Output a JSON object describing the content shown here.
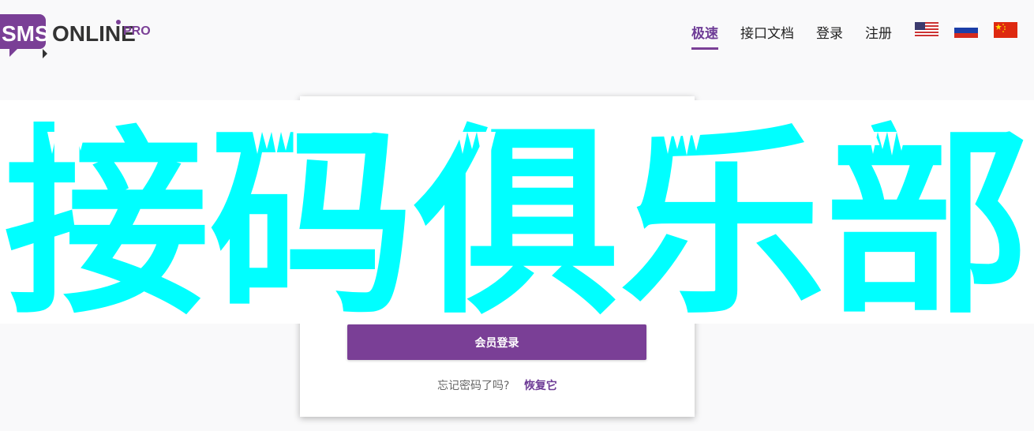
{
  "logo": {
    "sms": "SMS",
    "online": "ONLINE",
    "pro": "PRO"
  },
  "nav": {
    "items": [
      {
        "label": "极速",
        "active": true
      },
      {
        "label": "接口文档",
        "active": false
      },
      {
        "label": "登录",
        "active": false
      },
      {
        "label": "注册",
        "active": false
      }
    ],
    "flags": [
      "us-flag-icon",
      "russia-flag-icon",
      "china-flag-icon"
    ]
  },
  "banner": {
    "text": "接码俱乐部"
  },
  "login": {
    "button_label": "会员登录",
    "forgot_text": "忘记密码了吗?",
    "recover_label": "恢复它"
  },
  "colors": {
    "brand": "#7a3f96",
    "banner_text": "#00ffff"
  }
}
